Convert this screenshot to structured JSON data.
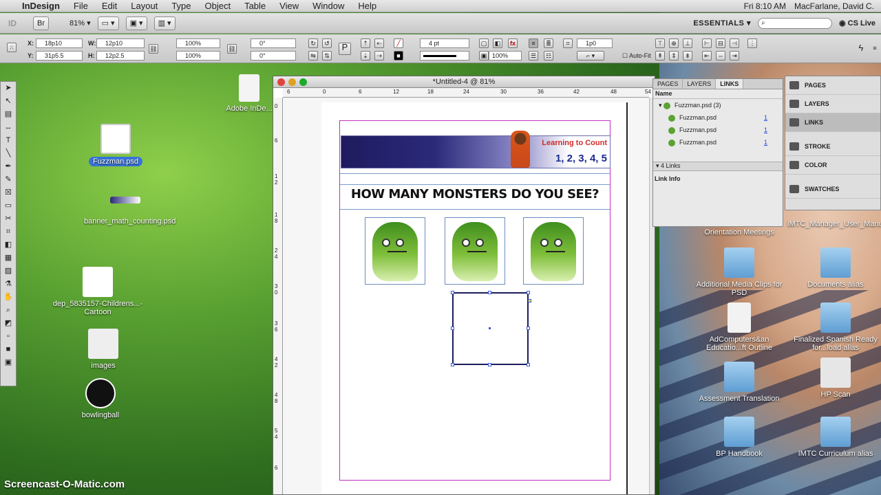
{
  "menubar": {
    "app": "InDesign",
    "items": [
      "File",
      "Edit",
      "Layout",
      "Type",
      "Object",
      "Table",
      "View",
      "Window",
      "Help"
    ],
    "clock": "Fri 8:10 AM",
    "user": "MacFarlane, David C."
  },
  "appbar": {
    "logo": "ID",
    "bridge": "Br",
    "zoom": "81%",
    "workspace": "ESSENTIALS",
    "cs_live": "CS Live"
  },
  "control": {
    "x": "18p10",
    "y": "31p5.5",
    "w": "12p10",
    "h": "12p2.5",
    "scale_x": "100%",
    "scale_y": "100%",
    "rotate": "0°",
    "shear": "0°",
    "stroke_weight": "4 pt",
    "opacity": "100%",
    "offset": "1p0",
    "auto_fit": "Auto-Fit",
    "labels": {
      "x": "X:",
      "y": "Y:",
      "w": "W:",
      "h": "H:"
    }
  },
  "document": {
    "title": "*Untitled-4 @ 81%",
    "ruler_h": [
      "6",
      "0",
      "6",
      "12",
      "18",
      "24",
      "30",
      "36",
      "42",
      "48",
      "54"
    ],
    "ruler_v": [
      "0",
      "6",
      "1\n2",
      "1\n8",
      "2\n4",
      "3\n0",
      "3\n6",
      "4\n2",
      "4\n8",
      "5\n4",
      "6"
    ],
    "banner_title": "Learning to Count",
    "banner_numbers": "1, 2, 3, 4, 5",
    "headline": "HOW MANY MONSTERS DO YOU SEE?"
  },
  "links_panel": {
    "tabs": [
      "PAGES",
      "LAYERS",
      "LINKS"
    ],
    "column_name": "Name",
    "group": "Fuzzman.psd (3)",
    "rows": [
      {
        "name": "Fuzzman.psd",
        "page": "1"
      },
      {
        "name": "Fuzzman.psd",
        "page": "1"
      },
      {
        "name": "Fuzzman.psd",
        "page": "1"
      }
    ],
    "footer": "4 Links",
    "info": "Link Info"
  },
  "dock": [
    "PAGES",
    "LAYERS",
    "LINKS",
    "STROKE",
    "COLOR",
    "SWATCHES"
  ],
  "desktop_left": [
    {
      "label": "Fuzzman.psd"
    },
    {
      "label": "banner_math_counting.psd"
    },
    {
      "label": "dep_5835157-Childrens...-Cartoon"
    },
    {
      "label": "images"
    },
    {
      "label": "bowlingball"
    },
    {
      "label": "Adobe InDe..."
    }
  ],
  "desktop_right": [
    {
      "label": "Orientation Meetings"
    },
    {
      "label": "iMTC_Manager_User_Manual.pdf"
    },
    {
      "label": "Additional Media Clips for PSD"
    },
    {
      "label": "Documents alias"
    },
    {
      "label": "AdComputers&an Educatio...ft Outline"
    },
    {
      "label": "Finalized Spanish Ready for...load alias"
    },
    {
      "label": "Assessment Translation"
    },
    {
      "label": "HP Scan"
    },
    {
      "label": "BP Handbook"
    },
    {
      "label": "IMTC Curriculum alias"
    }
  ],
  "watermark": "Screencast-O-Matic.com"
}
